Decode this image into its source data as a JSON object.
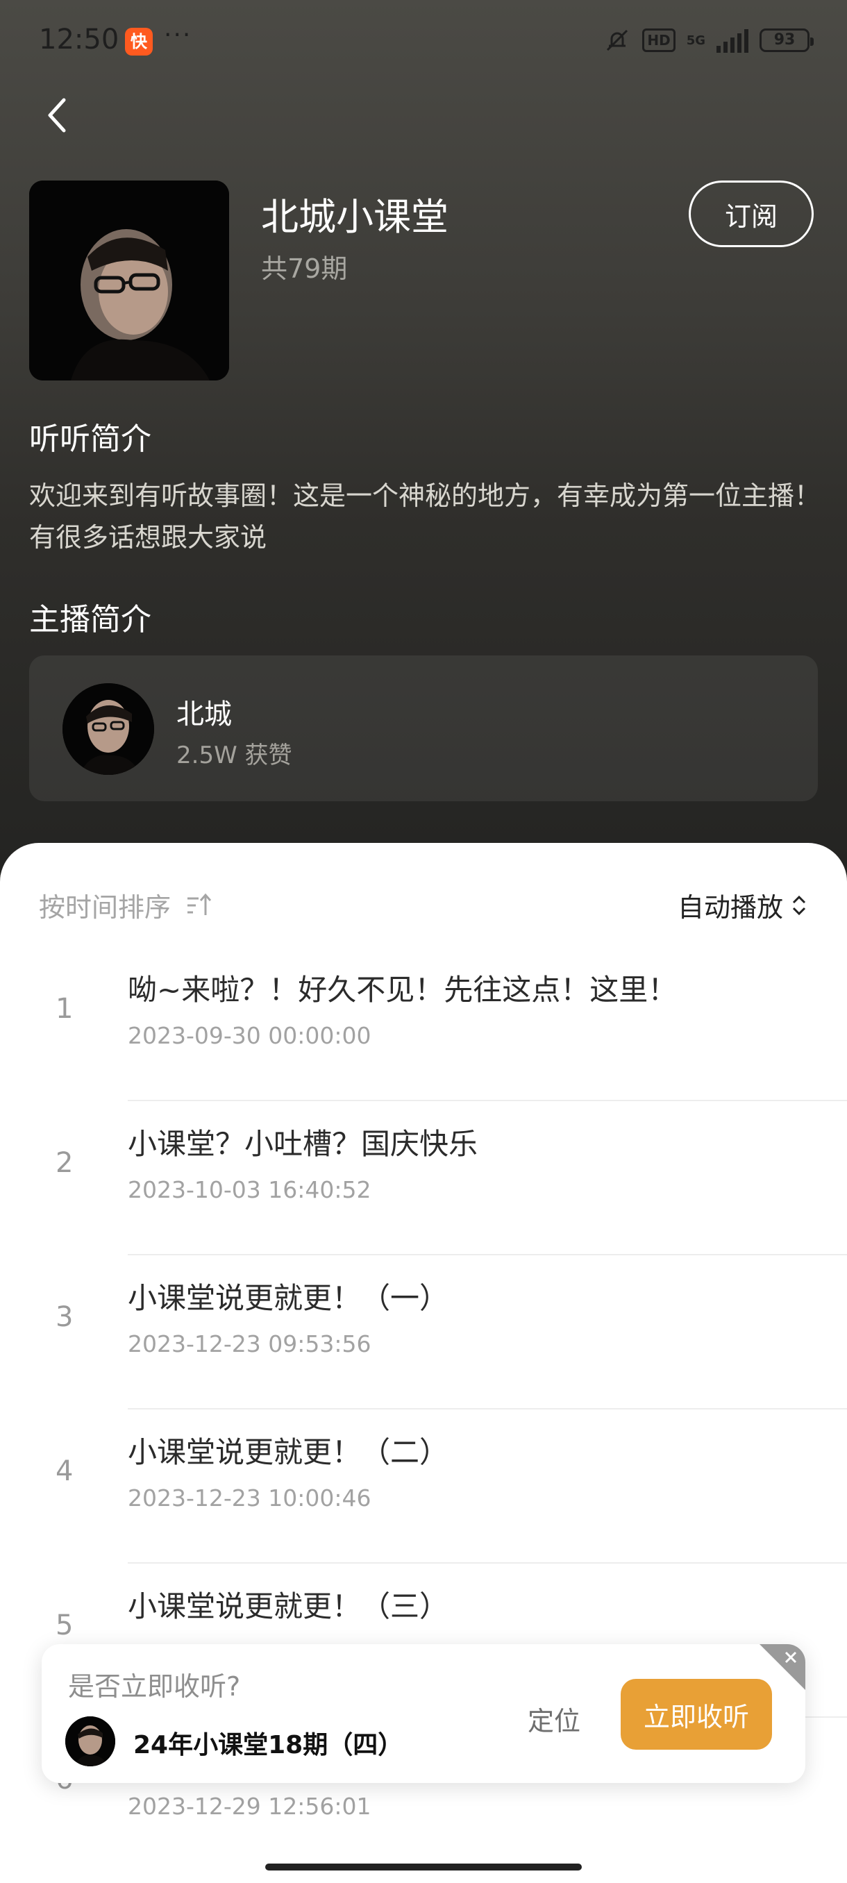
{
  "status_bar": {
    "time": "12:50",
    "app_badge": "快",
    "dots": "···",
    "hd": "HD",
    "network": "5G",
    "battery": "93"
  },
  "album": {
    "title": "北城小课堂",
    "count": "共79期",
    "subscribe_label": "订阅"
  },
  "intro": {
    "heading": "听听简介",
    "text": "欢迎来到有听故事圈！这是一个神秘的地方，有幸成为第一位主播！有很多话想跟大家说"
  },
  "host": {
    "heading": "主播简介",
    "name": "北城",
    "likes": "2.5W 获赞"
  },
  "list_header": {
    "sort_label": "按时间排序",
    "autoplay_label": "自动播放"
  },
  "episodes": [
    {
      "num": "1",
      "title": "呦~来啦？！好久不见！先往这点！这里！",
      "date": "2023-09-30 00:00:00"
    },
    {
      "num": "2",
      "title": "小课堂？小吐槽？国庆快乐",
      "date": "2023-10-03 16:40:52"
    },
    {
      "num": "3",
      "title": "小课堂说更就更！（一）",
      "date": "2023-12-23 09:53:56"
    },
    {
      "num": "4",
      "title": "小课堂说更就更！（二）",
      "date": "2023-12-23 10:00:46"
    },
    {
      "num": "5",
      "title": "小课堂说更就更！（三）",
      "date": ""
    },
    {
      "num": "6",
      "title": "",
      "date": "2023-12-29 12:56:01"
    }
  ],
  "popup": {
    "question": "是否立即收听?",
    "episode_name": "24年小课堂18期（四）",
    "locate_label": "定位",
    "listen_label": "立即收听"
  },
  "colors": {
    "accent": "#e8a036",
    "hero_bg": "#3d3c38"
  }
}
